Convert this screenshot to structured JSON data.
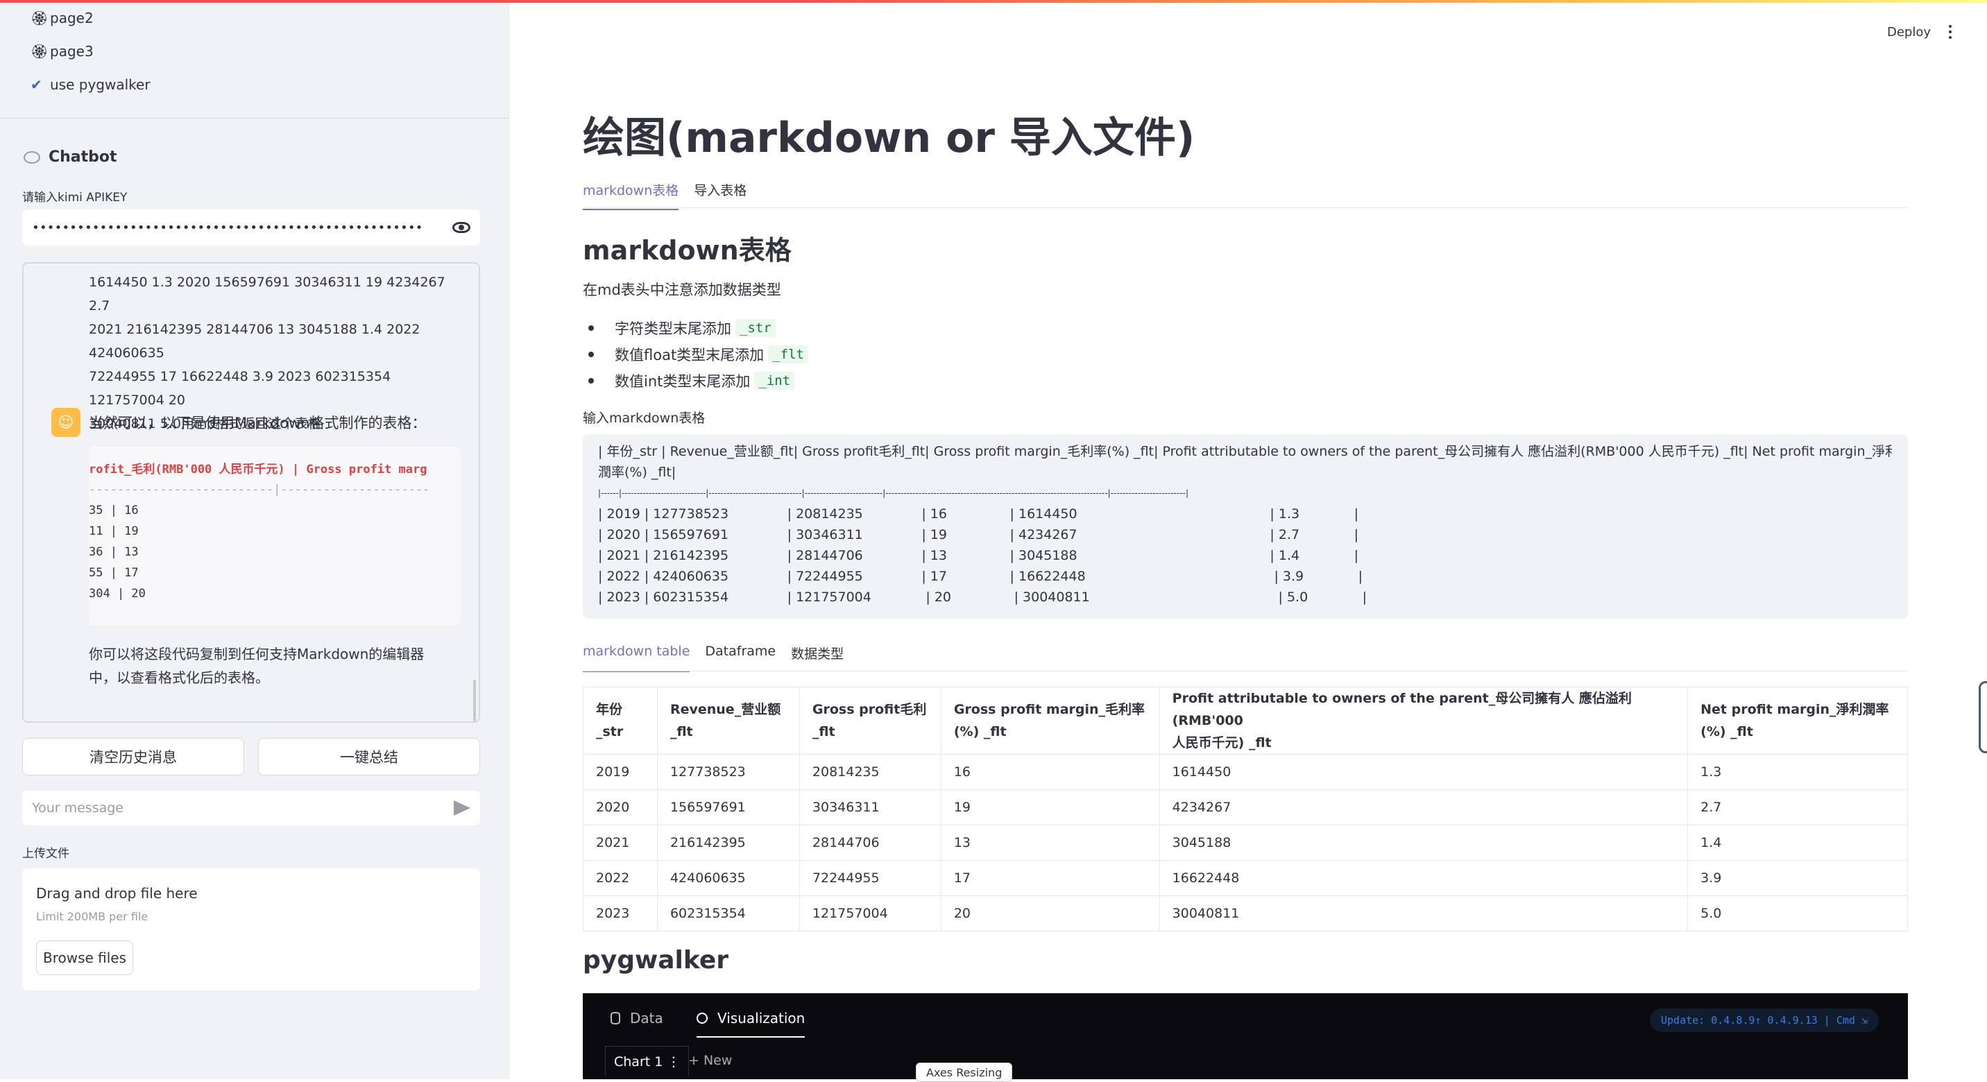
{
  "sidebar": {
    "nav": [
      {
        "label": "page2",
        "icon": "flower-emoji-icon"
      },
      {
        "label": "page3",
        "icon": "flower-emoji-icon"
      },
      {
        "label": "use pygwalker",
        "icon": "checkmark-icon"
      }
    ],
    "chatbot_title": "Chatbot",
    "api_label": "请输入kimi APIKEY",
    "api_value": "••••••••••••••••••••••••••••••••••••••••••••••••••••",
    "user_message_lines": [
      "1614450 1.3 2020 156597691 30346311 19 4234267 2.7",
      "2021 216142395 28144706 13 3045188 1.4 2022 424060635",
      "72244955 17 16622448 3.9 2023 602315354 121757004 20",
      "30040811 5.0用md格式返回这个表格"
    ],
    "bot_reply_intro": "当然可以，以下是使用Markdown格式制作的表格：",
    "code_header": "rofit_毛利(RMB'000 人民币千元) | Gross profit marg",
    "code_separator": "--------------------------|---------------------",
    "code_rows": [
      "35                         | 16",
      "11                         | 19",
      "36                         | 13",
      "55                         | 17",
      "304                        | 20"
    ],
    "bot_reply_outro": "你可以将这段代码复制到任何支持Markdown的编辑器中，以查看格式化后的表格。",
    "clear_button": "清空历史消息",
    "summary_button": "一键总结",
    "message_placeholder": "Your message",
    "upload_label": "上传文件",
    "upload_drag": "Drag and drop file here",
    "upload_limit": "Limit 200MB per file",
    "browse_button": "Browse files"
  },
  "header": {
    "deploy": "Deploy"
  },
  "main": {
    "title": "绘图(markdown or 导入文件)",
    "top_tabs": [
      "markdown表格",
      "导入表格"
    ],
    "section_title": "markdown表格",
    "intro": "在md表头中注意添加数据类型",
    "bullets": [
      {
        "text": "字符类型末尾添加",
        "code": "_str"
      },
      {
        "text": "数值float类型末尾添加",
        "code": "_flt"
      },
      {
        "text": "数值int类型末尾添加",
        "code": "_int"
      }
    ],
    "input_label": "输入markdown表格",
    "md_lines": [
      "| 年份_str | Revenue_营业额_flt| Gross profit毛利_flt| Gross profit margin_毛利率(%) _flt| Profit attributable to owners of the parent_母公司擁有人 應佔溢利(RMB'000 人民币千元) _flt| Net profit margin_淨利",
      "潤率(%) _flt|",
      "|------|----------------------------|-------------------------------|--------------------------|--------------------------------------------------------------------------|-------------------------|",
      "| 2019 | 127738523              | 20814235              | 16               | 1614450                                              | 1.3             |",
      "| 2020 | 156597691              | 30346311              | 19               | 4234267                                              | 2.7             |",
      "| 2021 | 216142395              | 28144706              | 13               | 3045188                                              | 1.4             |",
      "| 2022 | 424060635              | 72244955              | 17               | 16622448                                             | 3.9             |",
      "| 2023 | 602315354              | 121757004             | 20               | 30040811                                             | 5.0             |"
    ],
    "sub_tabs": [
      "markdown table",
      "Dataframe",
      "数据类型"
    ],
    "table": {
      "headers": [
        "年份\n_str",
        "Revenue_营业额\n_flt",
        "Gross profit毛利\n_flt",
        "Gross profit margin_毛利率\n(%) _flt",
        "Profit attributable to owners of the parent_母公司擁有人 應佔溢利(RMB'000\n人民币千元) _flt",
        "Net profit margin_淨利潤率\n(%) _flt"
      ],
      "rows": [
        [
          "2019",
          "127738523",
          "20814235",
          "16",
          "1614450",
          "1.3"
        ],
        [
          "2020",
          "156597691",
          "30346311",
          "19",
          "4234267",
          "2.7"
        ],
        [
          "2021",
          "216142395",
          "28144706",
          "13",
          "3045188",
          "1.4"
        ],
        [
          "2022",
          "424060635",
          "72244955",
          "17",
          "16622448",
          "3.9"
        ],
        [
          "2023",
          "602315354",
          "121757004",
          "20",
          "30040811",
          "5.0"
        ]
      ]
    },
    "pygwalker_title": "pygwalker",
    "pygwalker": {
      "data_tab": "Data",
      "viz_tab": "Visualization",
      "update_text": "Update: 0.4.8.9↑ 0.4.9.13 | Cmd ⇲",
      "chart_tab": "Chart 1 ⋮",
      "new_tab": "+ New",
      "axes_resizing": "Axes Resizing"
    }
  }
}
